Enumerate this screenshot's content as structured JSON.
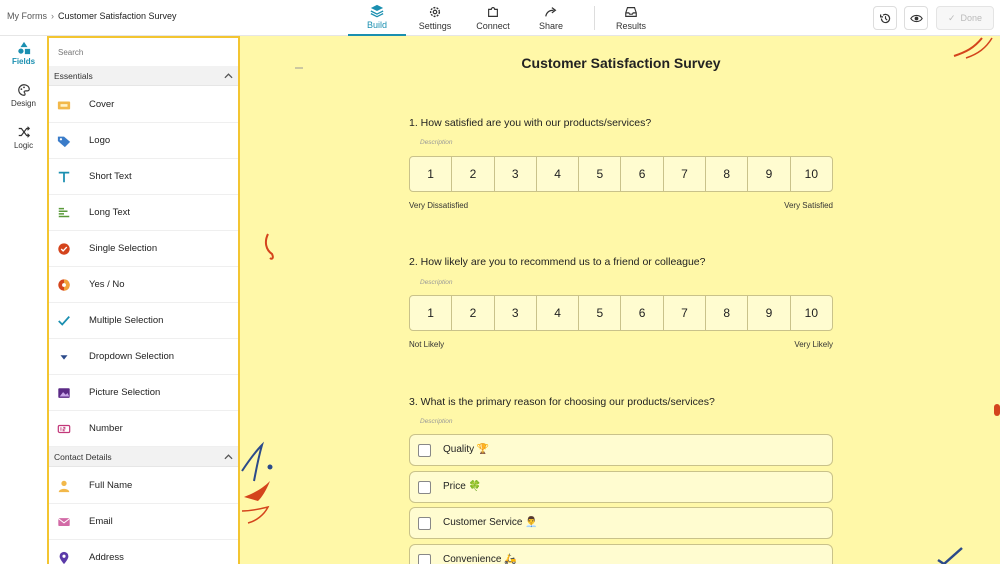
{
  "breadcrumb": {
    "parent": "My Forms",
    "separator": "›",
    "current": "Customer Satisfaction Survey"
  },
  "nav": {
    "tabs": [
      {
        "label": "Build",
        "icon": "layers-icon"
      },
      {
        "label": "Settings",
        "icon": "gear-icon"
      },
      {
        "label": "Connect",
        "icon": "puzzle-icon"
      },
      {
        "label": "Share",
        "icon": "share-arrow-icon"
      },
      {
        "label": "Results",
        "icon": "inbox-icon"
      }
    ],
    "done_label": "Done",
    "done_check": "✓"
  },
  "rail": [
    {
      "label": "Fields",
      "icon": "shapes-icon"
    },
    {
      "label": "Design",
      "icon": "palette-icon"
    },
    {
      "label": "Logic",
      "icon": "shuffle-icon"
    }
  ],
  "panel": {
    "search_placeholder": "Search",
    "sections": [
      {
        "title": "Essentials",
        "items": [
          {
            "label": "Cover",
            "icon": "cover-image-icon"
          },
          {
            "label": "Logo",
            "icon": "tag-icon"
          },
          {
            "label": "Short Text",
            "icon": "text-t-icon"
          },
          {
            "label": "Long Text",
            "icon": "paragraph-lines-icon"
          },
          {
            "label": "Single Selection",
            "icon": "radio-check-icon"
          },
          {
            "label": "Yes / No",
            "icon": "yes-no-icon"
          },
          {
            "label": "Multiple Selection",
            "icon": "checkmark-icon"
          },
          {
            "label": "Dropdown Selection",
            "icon": "caret-down-icon"
          },
          {
            "label": "Picture Selection",
            "icon": "picture-icon"
          },
          {
            "label": "Number",
            "icon": "number-field-icon"
          }
        ]
      },
      {
        "title": "Contact Details",
        "items": [
          {
            "label": "Full Name",
            "icon": "person-icon"
          },
          {
            "label": "Email",
            "icon": "envelope-icon"
          },
          {
            "label": "Address",
            "icon": "location-pin-icon"
          }
        ]
      }
    ]
  },
  "form": {
    "title": "Customer Satisfaction Survey",
    "questions": [
      {
        "text": "1. How satisfied are you with our products/services?",
        "description": "Description",
        "scale": [
          "1",
          "2",
          "3",
          "4",
          "5",
          "6",
          "7",
          "8",
          "9",
          "10"
        ],
        "min_label": "Very Dissatisfied",
        "max_label": "Very Satisfied"
      },
      {
        "text": "2. How likely are you to recommend us to a friend or colleague?",
        "description": "Description",
        "scale": [
          "1",
          "2",
          "3",
          "4",
          "5",
          "6",
          "7",
          "8",
          "9",
          "10"
        ],
        "min_label": "Not Likely",
        "max_label": "Very Likely"
      },
      {
        "text": "3. What is the primary reason for choosing our products/services?",
        "description": "Description",
        "options": [
          "Quality 🏆",
          "Price 🍀",
          "Customer Service 👨‍💼",
          "Convenience 🛵"
        ]
      }
    ]
  },
  "colors": {
    "accent": "#1a8fb0",
    "panel_border": "#f3c531",
    "canvas_bg": "#fff8a8"
  }
}
